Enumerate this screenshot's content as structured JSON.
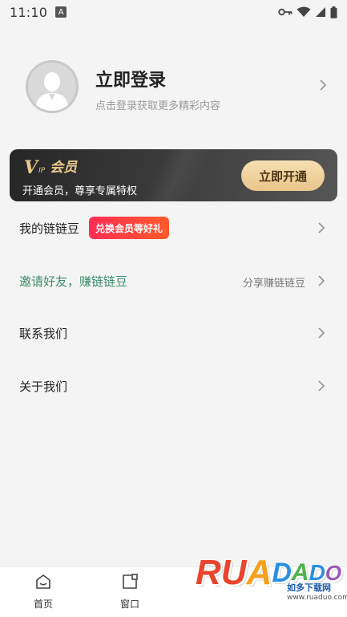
{
  "status_bar": {
    "time": "11:10",
    "notification_glyph": "A",
    "icons": [
      "key-icon",
      "wifi-icon",
      "signal-icon",
      "battery-icon"
    ]
  },
  "profile": {
    "title": "立即登录",
    "subtitle": "点击登录获取更多精彩内容"
  },
  "vip": {
    "logo_v": "V",
    "logo_ip": "IP",
    "logo_word": "会员",
    "description": "开通会员，尊享专属特权",
    "button_label": "立即开通",
    "colors": {
      "gold": "#e9c98d",
      "card_dark": "#262626"
    }
  },
  "menu": {
    "items": [
      {
        "label": "我的链链豆",
        "badge": "兑换会员等好礼",
        "extra": ""
      },
      {
        "label": "邀请好友，赚链链豆",
        "badge": "",
        "extra": "分享赚链链豆"
      },
      {
        "label": "联系我们",
        "badge": "",
        "extra": ""
      },
      {
        "label": "关于我们",
        "badge": "",
        "extra": ""
      }
    ],
    "accent_green": "#3c8c6b",
    "badge_color": "#ff2d55"
  },
  "tab_bar": {
    "tabs": [
      {
        "label": "首页",
        "icon": "home-icon"
      },
      {
        "label": "窗口",
        "icon": "window-icon"
      }
    ]
  },
  "watermark": {
    "letters": [
      "R",
      "U",
      "A",
      "D",
      "A",
      "D",
      "O"
    ],
    "subtitle": "如多下载网",
    "url": "www.ruaduo.com"
  }
}
